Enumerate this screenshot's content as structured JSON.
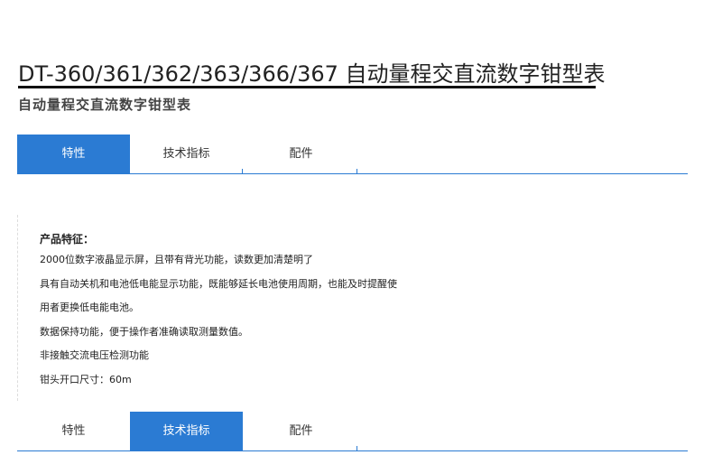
{
  "page": {
    "title": "DT-360/361/362/363/366/367 自动量程交直流数字钳型表",
    "subtitle": "自动量程交直流数字钳型表"
  },
  "tabs_top": {
    "items": [
      {
        "label": "特性"
      },
      {
        "label": "技术指标"
      },
      {
        "label": "配件"
      }
    ],
    "active": "特性"
  },
  "features": {
    "heading": "产品特征：",
    "items": [
      "2000位数字液晶显示屏，且带有背光功能，读数更加清楚明了",
      "具有自动关机和电池低电能显示功能，既能够延长电池使用周期，也能及时提醒使",
      "用者更换低电能电池。",
      "数据保持功能，便于操作者准确读取测量数值。",
      "非接触交流电压检测功能",
      "钳头开口尺寸：60m"
    ]
  },
  "tabs_bottom": {
    "items": [
      {
        "label": "特性"
      },
      {
        "label": "技术指标"
      },
      {
        "label": "配件"
      }
    ],
    "active": "技术指标"
  },
  "colors": {
    "accent": "#2b7bd3"
  }
}
